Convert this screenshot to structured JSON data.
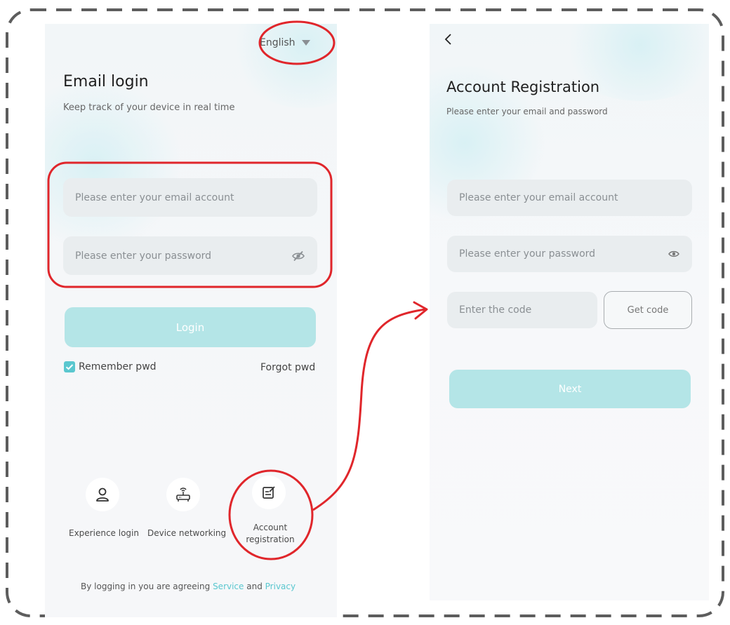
{
  "login_screen": {
    "language": "English",
    "title": "Email login",
    "subtitle": "Keep track of your device in real time",
    "email_placeholder": "Please enter your email account",
    "password_placeholder": "Please enter your password",
    "login_label": "Login",
    "remember_label": "Remember pwd",
    "forgot_label": "Forgot pwd",
    "actions": [
      {
        "label": "Experience login",
        "icon": "user-icon"
      },
      {
        "label": "Device networking",
        "icon": "router-icon"
      },
      {
        "label_line1": "Account",
        "label_line2": "registration",
        "icon": "edit-form-icon"
      }
    ],
    "footer": {
      "prefix": "By logging in you are agreeing",
      "service": "Service",
      "and": "and",
      "privacy": "Privacy"
    }
  },
  "register_screen": {
    "back_glyph": "<",
    "title": "Account Registration",
    "subtitle": "Please enter your email and password",
    "email_placeholder": "Please enter your email account",
    "password_placeholder": "Please enter your password",
    "code_placeholder": "Enter the code",
    "get_code_label": "Get code",
    "next_label": "Next"
  },
  "colors": {
    "accent": "#5ac7cf",
    "button_disabled": "#b4e5e7",
    "annotation_red": "#e0262b",
    "field_bg": "#e9edef"
  }
}
